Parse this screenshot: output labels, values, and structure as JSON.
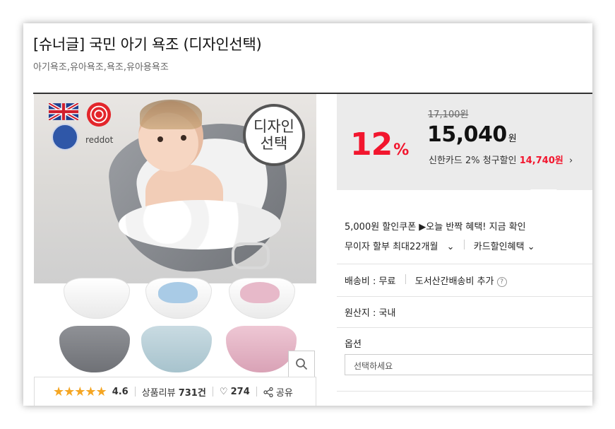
{
  "product": {
    "title": "[슈너글] 국민 아기 욕조 (디자인선택)",
    "tags": "아기욕조,유아욕조,욕조,유아용욕조"
  },
  "image": {
    "badge": "디자인\n선택",
    "brand_badge": "reddot",
    "zoom_icon": "magnifier-icon"
  },
  "rating": {
    "stars": "★★★★★",
    "score": "4.6",
    "review_label": "상품리뷰",
    "review_count": "731건",
    "like_count": "274",
    "share_label": "공유"
  },
  "price": {
    "discount_rate": "12",
    "discount_unit": "%",
    "original": "17,100원",
    "sale": "15,040",
    "sale_unit": "원",
    "card_text": "신한카드 2% 청구할인",
    "card_price": "14,740원",
    "card_arrow": "›"
  },
  "benefits": {
    "coupon": "5,000원 할인쿠폰 ▶오늘 반짝 혜택! 지금 확인",
    "installment": "무이자 할부 최대22개월",
    "installment_arrow": "⌄",
    "card_benefit": "카드할인혜택",
    "card_benefit_arrow": "⌄"
  },
  "shipping": {
    "fee": "배송비 : 무료",
    "extra": "도서산간배송비 추가",
    "help": "?"
  },
  "origin": "원산지 : 국내",
  "option": {
    "label": "옵션",
    "placeholder": "선택하세요"
  },
  "colors": {
    "accent": "#f2162e",
    "star": "#f5a623",
    "panel": "#ebebeb"
  }
}
